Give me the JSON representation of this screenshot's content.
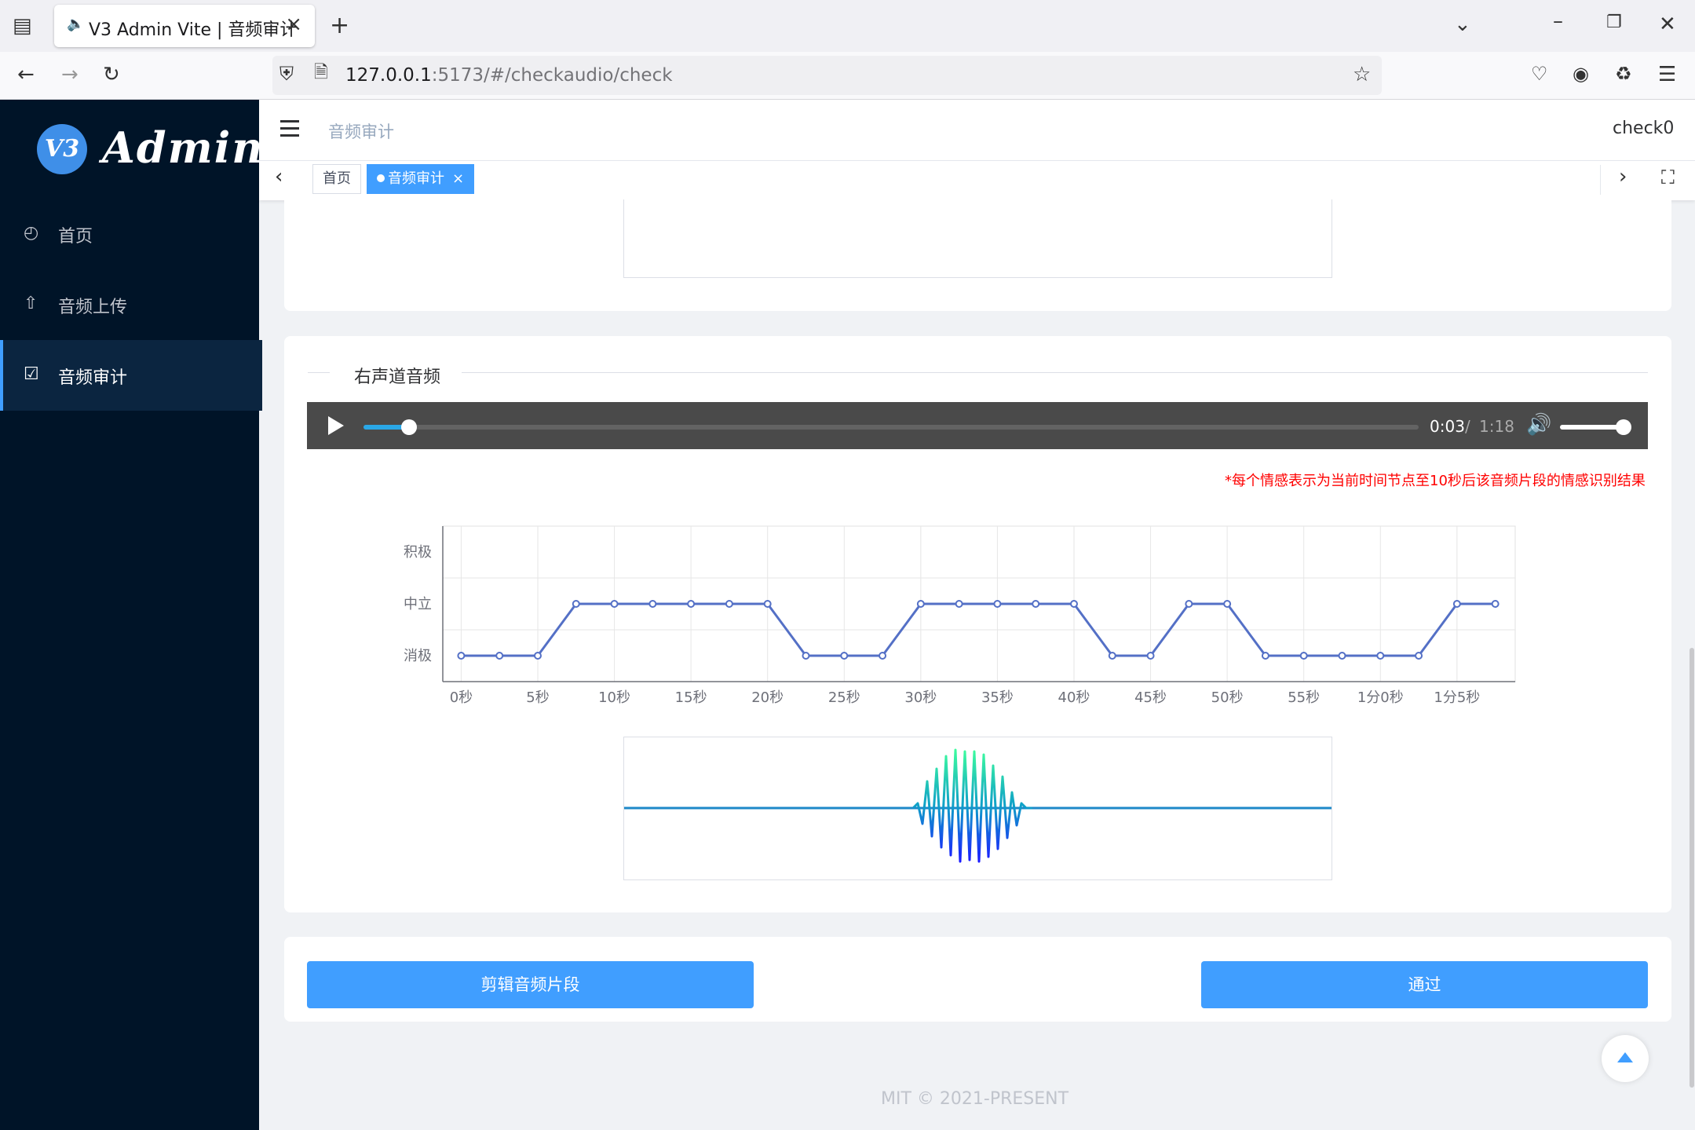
{
  "browser": {
    "tab_title": "V3 Admin Vite | 音频审计",
    "url_host": "127.0.0.1",
    "url_rest": ":5173/#/checkaudio/check"
  },
  "sidebar": {
    "logo_badge": "V3",
    "logo_text": "Admin",
    "items": [
      {
        "label": "首页",
        "icon": "dashboard-icon",
        "active": false
      },
      {
        "label": "音频上传",
        "icon": "upload-icon",
        "active": false
      },
      {
        "label": "音频审计",
        "icon": "checkbox-icon",
        "active": true
      }
    ]
  },
  "header": {
    "breadcrumb": "音频审计",
    "username": "check0"
  },
  "tags": {
    "home": "首页",
    "active": "音频审计",
    "close": "×"
  },
  "section": {
    "title": "右声道音频"
  },
  "player": {
    "current_time": "0:03",
    "separator": "/",
    "duration": "1:18",
    "progress_fraction": 0.043,
    "volume_fraction": 1.0
  },
  "note": "*每个情感表示为当前时间节点至10秒后该音频片段的情感识别结果",
  "chart_data": {
    "type": "line",
    "categories": [
      "积极",
      "中立",
      "消极"
    ],
    "x_tick_labels": [
      "0秒",
      "5秒",
      "10秒",
      "15秒",
      "20秒",
      "25秒",
      "30秒",
      "35秒",
      "40秒",
      "45秒",
      "50秒",
      "55秒",
      "1分0秒",
      "1分5秒"
    ],
    "x": [
      0,
      2.5,
      5,
      7.5,
      10,
      12.5,
      15,
      17.5,
      20,
      22.5,
      25,
      27.5,
      30,
      32.5,
      35,
      37.5,
      40,
      42.5,
      45,
      47.5,
      50,
      52.5,
      55,
      57.5,
      60,
      62.5,
      65,
      67.5
    ],
    "values": [
      "消极",
      "消极",
      "消极",
      "中立",
      "中立",
      "中立",
      "中立",
      "中立",
      "中立",
      "消极",
      "消极",
      "消极",
      "中立",
      "中立",
      "中立",
      "中立",
      "中立",
      "消极",
      "消极",
      "中立",
      "中立",
      "消极",
      "消极",
      "消极",
      "消极",
      "消极",
      "中立",
      "中立"
    ],
    "xlim": [
      -1.2,
      68.8
    ],
    "grid": true,
    "color": "#5470c6"
  },
  "buttons": {
    "cut": "剪辑音频片段",
    "pass": "通过"
  },
  "footer": "MIT © 2021-PRESENT"
}
